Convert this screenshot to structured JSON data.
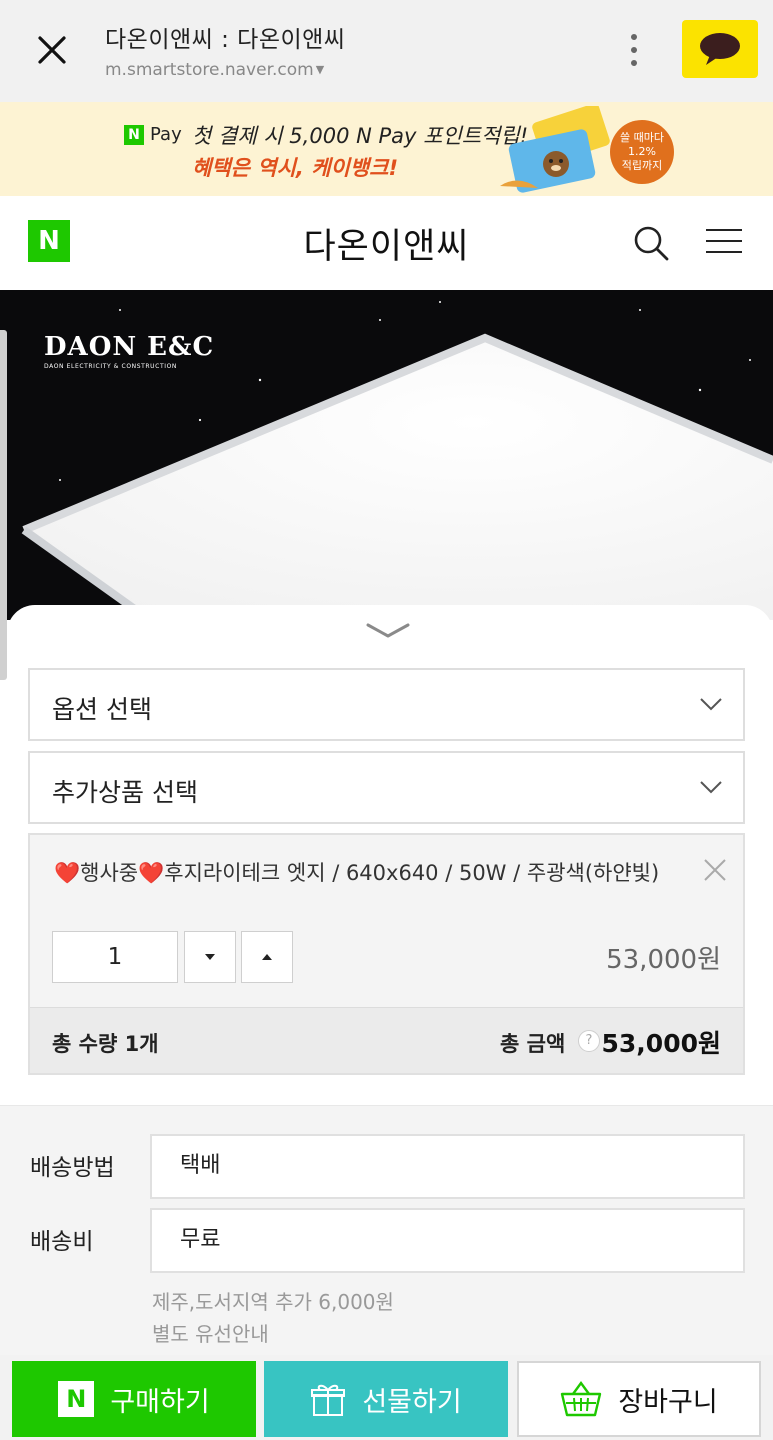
{
  "browser": {
    "title": "다온이앤씨 : 다온이앤씨",
    "url": "m.smartstore.naver.com",
    "close_icon": "close-icon",
    "more_icon": "more-vertical-icon",
    "talk_icon": "kakaotalk-icon"
  },
  "promo": {
    "npay_n": "N",
    "npay_label": "Pay",
    "line1": "첫 결제 시 5,000 N Pay 포인트적립!",
    "line2": "혜택은 역시, 케이뱅크!",
    "badge_line1": "쓸 때마다",
    "badge_line2": "1.2%",
    "badge_line3": "적립까지"
  },
  "store": {
    "logo": "N",
    "name": "다온이앤씨",
    "search_icon": "search-icon",
    "menu_icon": "hamburger-menu-icon"
  },
  "hero": {
    "brand": "DAON E&C",
    "brand_sub": "DAON ELECTRICITY & CONSTRUCTION"
  },
  "order": {
    "option_select": "옵션 선택",
    "addon_select": "추가상품 선택",
    "item": {
      "heart": "❤️",
      "name_part1": "행사중",
      "name_part2": "후지라이테크 엣지 / 640x640 / 50W / 주광색(하얀빛)",
      "quantity": "1",
      "price": "53,000원"
    },
    "total_qty_label": "총 수량",
    "total_qty": "1개",
    "total_amount_label": "총 금액",
    "help": "?",
    "total_amount": "53,000원"
  },
  "shipping": {
    "method_label": "배송방법",
    "method_value": "택배",
    "fee_label": "배송비",
    "fee_value": "무료",
    "note1": "제주,도서지역 추가 6,000원",
    "note2": "별도 유선안내"
  },
  "actions": {
    "buy": "구매하기",
    "buy_logo": "N",
    "gift": "선물하기",
    "cart": "장바구니"
  },
  "colors": {
    "naver_green": "#1ec800",
    "gift_teal": "#38c4c2",
    "kakao_yellow": "#fbe300",
    "promo_orange": "#e0501d"
  }
}
